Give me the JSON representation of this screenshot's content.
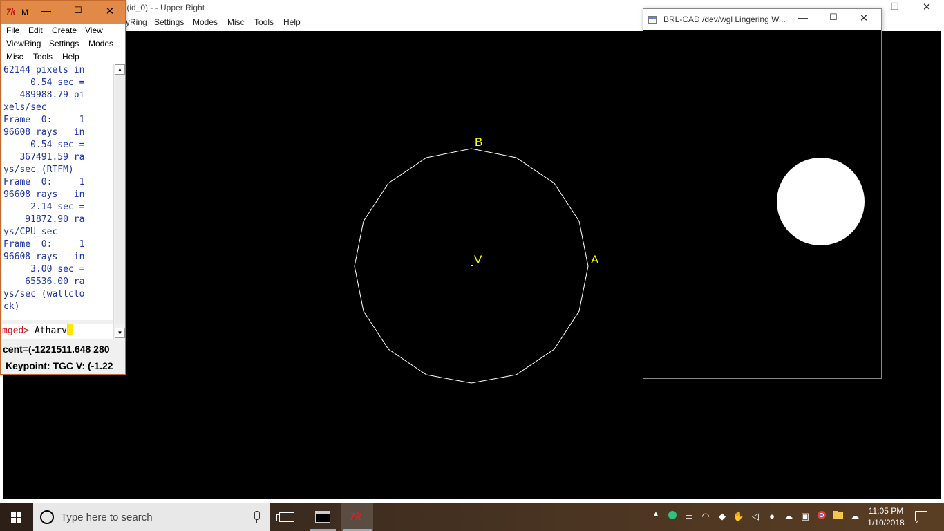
{
  "main_window": {
    "title": "v (id_0) -  - Upper Right",
    "menu": [
      "yRing",
      "Settings",
      "Modes",
      "Misc",
      "Tools",
      "Help"
    ],
    "labels": {
      "b": "B",
      "v": "V",
      "a": "A"
    },
    "colors": {
      "background": "#000000",
      "wireframe": "#ffffff",
      "labels": "#ffff00"
    }
  },
  "command_window": {
    "logo": "7k",
    "title": "M",
    "menu_rows": [
      [
        "File",
        "Edit",
        "Create",
        "View"
      ],
      [
        "ViewRing",
        "Settings",
        "Modes"
      ],
      [
        "Misc",
        "Tools",
        "Help"
      ]
    ],
    "output_lines": [
      "62144 pixels in",
      "     0.54 sec =",
      "   489988.79 pi",
      "xels/sec",
      "Frame  0:     1",
      "96608 rays   in",
      "     0.54 sec =",
      "   367491.59 ra",
      "ys/sec (RTFM)",
      "Frame  0:     1",
      "96608 rays   in",
      "     2.14 sec =",
      "    91872.90 ra",
      "ys/CPU_sec",
      "Frame  0:     1",
      "96608 rays   in",
      "     3.00 sec =",
      "    65536.00 ra",
      "ys/sec (wallclo",
      "ck)"
    ],
    "prompt": "mged> ",
    "input_value": "Atharv",
    "status_cent": "cent=(-1221511.648 280",
    "status_keypoint": "Keypoint: TGC V: (-1.22",
    "colors": {
      "titlebar": "#e18a48",
      "output_text": "#1a33a8",
      "prompt": "#d01818",
      "cursor": "#ffe600"
    }
  },
  "framebuffer_window": {
    "title": "BRL-CAD /dev/wgl Lingering W..."
  },
  "taskbar": {
    "search_placeholder": "Type here to search",
    "clock_time": "11:05 PM",
    "clock_date": "1/10/2018",
    "tray_icons": [
      "chat-icon",
      "battery-icon",
      "wifi-icon",
      "shield-icon",
      "hand-icon",
      "volume-icon",
      "fox-icon",
      "onedrive-icon",
      "monitor-icon",
      "chrome-icon",
      "folder-icon",
      "cloud-icon"
    ]
  }
}
